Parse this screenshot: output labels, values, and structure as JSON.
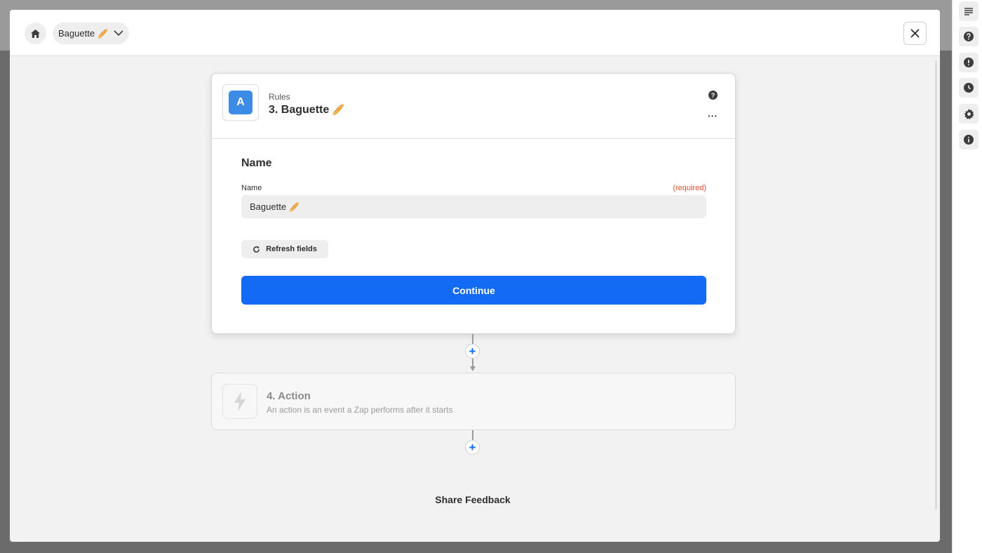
{
  "header": {
    "breadcrumb_label": "Baguette",
    "breadcrumb_emoji": "🥖"
  },
  "step_card": {
    "app_letter": "A",
    "app_name": "Rules",
    "title": "3. Baguette",
    "title_emoji": "🥖",
    "help_glyph": "?",
    "more_glyph": "···",
    "section_title": "Name",
    "field": {
      "label": "Name",
      "required_text": "(required)",
      "value": "Baguette",
      "value_emoji": "🥖"
    },
    "refresh_label": "Refresh fields",
    "continue_label": "Continue"
  },
  "action_card": {
    "title": "4. Action",
    "description": "An action is an event a Zap performs after it starts"
  },
  "footer": {
    "share_feedback": "Share Feedback"
  },
  "add_button_glyph": "+",
  "colors": {
    "primary": "#136bf5",
    "required": "#e2502f",
    "app_icon": "#3c8ce7"
  },
  "right_rail": [
    {
      "icon": "outline-icon"
    },
    {
      "icon": "help-circle-icon"
    },
    {
      "icon": "alert-circle-icon"
    },
    {
      "icon": "clock-icon"
    },
    {
      "icon": "gear-icon"
    },
    {
      "icon": "info-circle-icon"
    }
  ]
}
